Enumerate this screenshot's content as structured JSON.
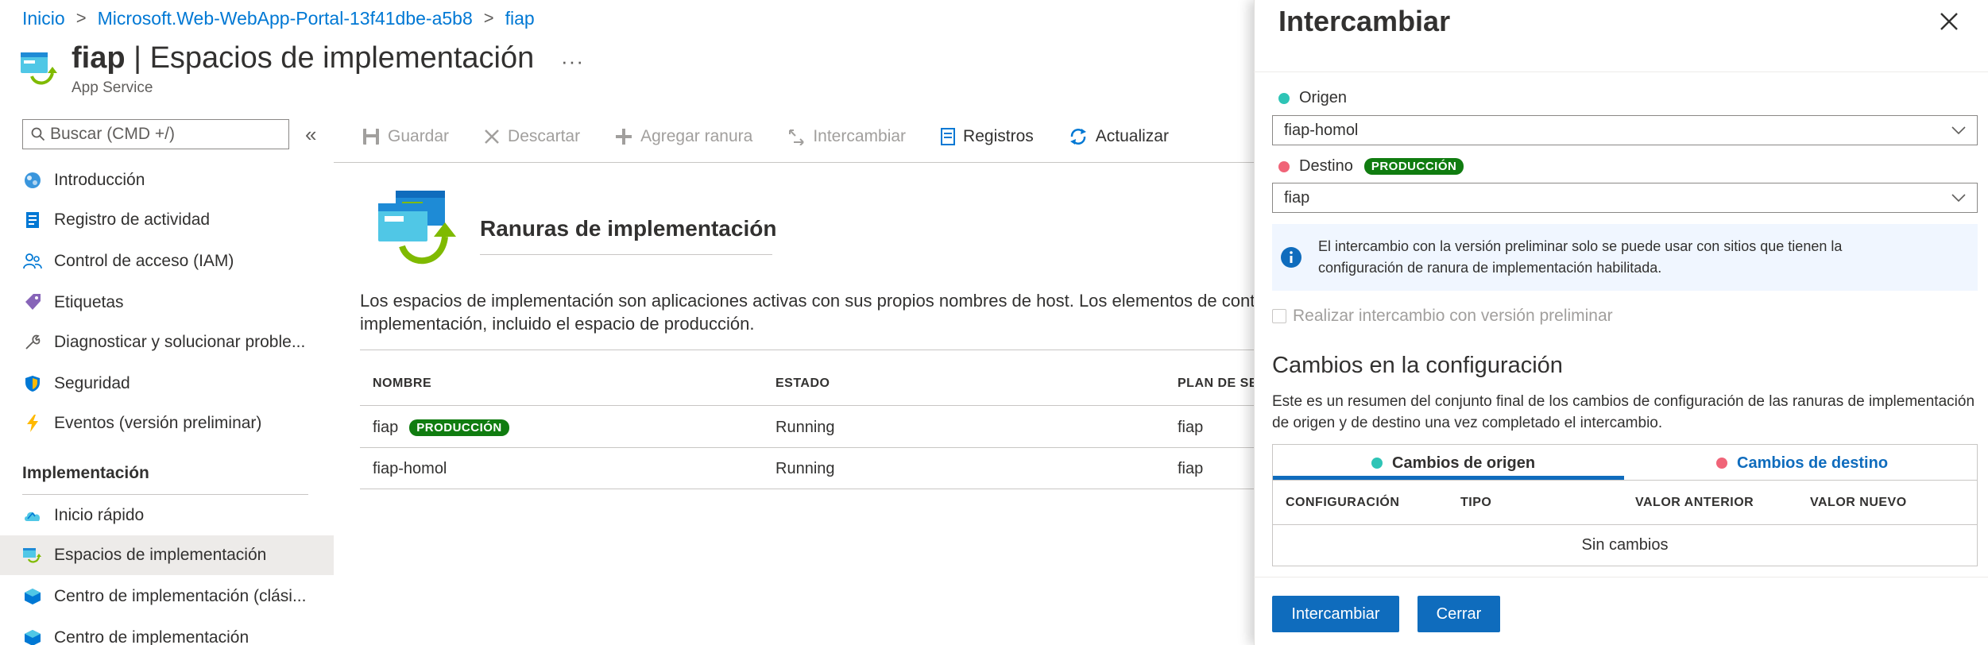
{
  "breadcrumb": [
    "Inicio",
    "Microsoft.Web-WebApp-Portal-13f41dbe-a5b8",
    "fiap"
  ],
  "header": {
    "resource_name": "fiap",
    "separator": " | ",
    "page_name": "Espacios de implementación",
    "subtitle": "App Service",
    "more": "···"
  },
  "search": {
    "placeholder": "Buscar (CMD +/)"
  },
  "sidebar": {
    "collapse": "«",
    "items": [
      {
        "label": "Introducción",
        "icon": "globe-icon"
      },
      {
        "label": "Registro de actividad",
        "icon": "activity-log-icon"
      },
      {
        "label": "Control de acceso (IAM)",
        "icon": "people-icon"
      },
      {
        "label": "Etiquetas",
        "icon": "tag-icon"
      },
      {
        "label": "Diagnosticar y solucionar proble...",
        "icon": "wrench-icon"
      },
      {
        "label": "Seguridad",
        "icon": "shield-icon"
      },
      {
        "label": "Eventos (versión preliminar)",
        "icon": "lightning-icon"
      }
    ],
    "section": "Implementación",
    "section_items": [
      {
        "label": "Inicio rápido",
        "icon": "cloud-icon"
      },
      {
        "label": "Espacios de implementación",
        "icon": "slots-icon",
        "selected": true
      },
      {
        "label": "Centro de implementación (clási...",
        "icon": "cube-icon"
      },
      {
        "label": "Centro de implementación",
        "icon": "cube-icon"
      }
    ]
  },
  "toolbar": {
    "save": "Guardar",
    "discard": "Descartar",
    "add_slot": "Agregar ranura",
    "swap": "Intercambiar",
    "logs": "Registros",
    "refresh": "Actualizar"
  },
  "content": {
    "title": "Ranuras de implementación",
    "description_line1": "Los espacios de implementación son aplicaciones activas con sus propios nombres de host. Los elementos de cont",
    "description_line2": "implementación, incluido el espacio de producción.",
    "table": {
      "columns": [
        "NOMBRE",
        "ESTADO",
        "PLAN DE SE"
      ],
      "rows": [
        {
          "name": "fiap",
          "badge": "PRODUCCIÓN",
          "status": "Running",
          "plan": "fiap"
        },
        {
          "name": "fiap-homol",
          "badge": "",
          "status": "Running",
          "plan": "fiap"
        }
      ]
    }
  },
  "panel": {
    "title": "Intercambiar",
    "source_label": "Origen",
    "source_value": "fiap-homol",
    "target_label": "Destino",
    "target_badge": "PRODUCCIÓN",
    "target_value": "fiap",
    "info_line1": "El intercambio con la versión preliminar solo se puede usar con sitios que tienen la",
    "info_line2": "configuración de ranura de implementación habilitada.",
    "preview_checkbox": "Realizar intercambio con versión preliminar",
    "changes_title": "Cambios en la configuración",
    "changes_desc": "Este es un resumen del conjunto final de los cambios de configuración de las ranuras de implementación de origen y de destino una vez completado el intercambio.",
    "tab_source": "Cambios de origen",
    "tab_target": "Cambios de destino",
    "columns": [
      "CONFIGURACIÓN",
      "TIPO",
      "VALOR ANTERIOR",
      "VALOR NUEVO"
    ],
    "empty": "Sin cambios",
    "swap_button": "Intercambiar",
    "close_button": "Cerrar"
  },
  "colors": {
    "accent": "#0f6cbd",
    "link": "#0078d4",
    "production_badge": "#107c10",
    "source_dot": "#2ec4b6",
    "target_dot": "#f06478"
  }
}
